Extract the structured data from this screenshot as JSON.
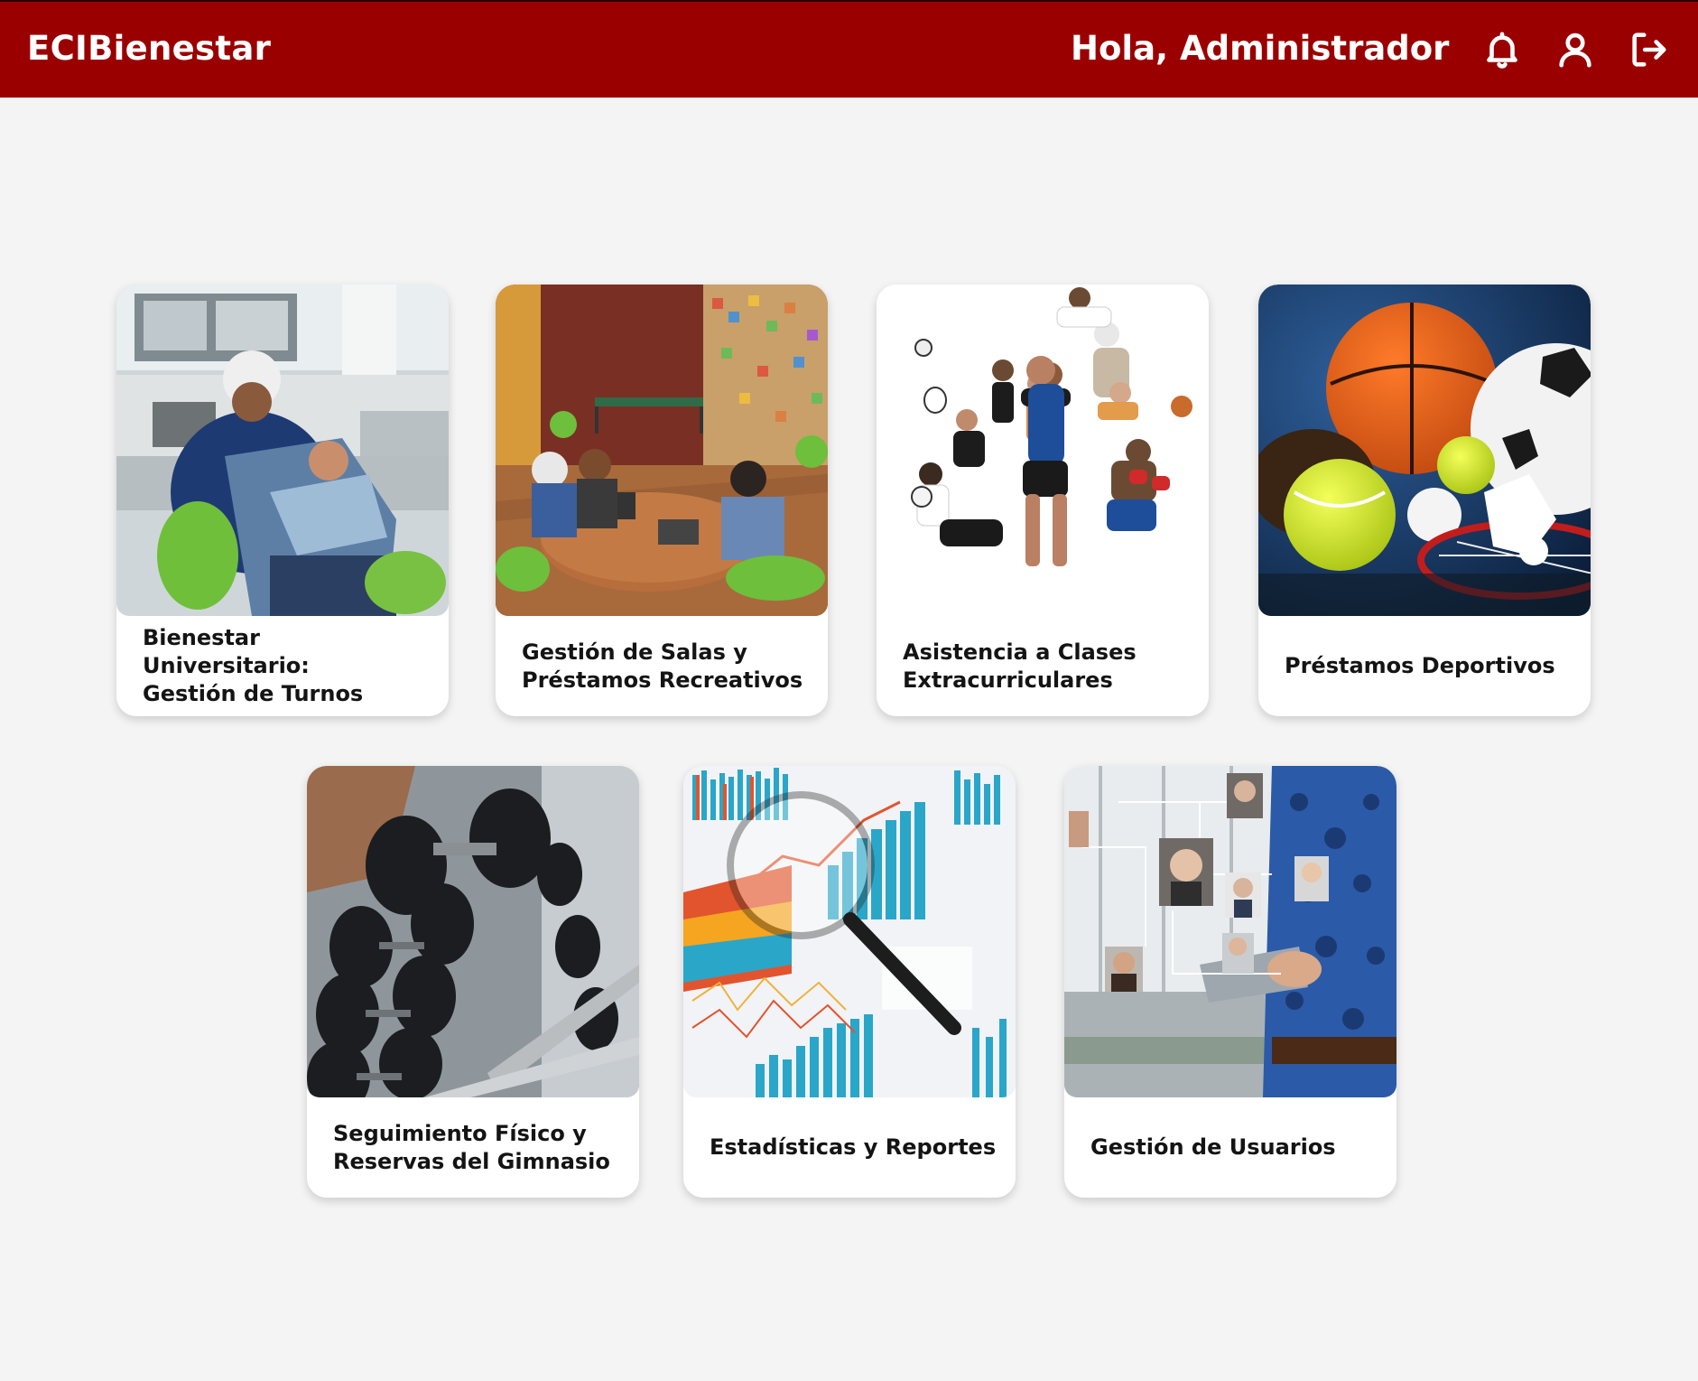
{
  "header": {
    "brand": "ECIBienestar",
    "greeting": "Hola, Administrador",
    "bar_color": "#9b0000",
    "icons": [
      "bell-icon",
      "user-icon",
      "logout-icon"
    ]
  },
  "modules": [
    {
      "title": "Bienestar Universitario:\nGestión de Turnos",
      "image": "dental-clinic-photo"
    },
    {
      "title": "Gestión de Salas y\nPréstamos Recreativos",
      "image": "recreation-room-photo"
    },
    {
      "title": "Asistencia a Clases\nExtracurriculares",
      "image": "athletes-collage-photo"
    },
    {
      "title": "Préstamos Deportivos",
      "image": "sports-balls-photo"
    },
    {
      "title": "Seguimiento Físico y\nReservas del Gimnasio",
      "image": "dumbbells-photo"
    },
    {
      "title": "Estadísticas y Reportes",
      "image": "charts-magnifier-photo"
    },
    {
      "title": "Gestión de Usuarios",
      "image": "user-network-photo"
    }
  ]
}
